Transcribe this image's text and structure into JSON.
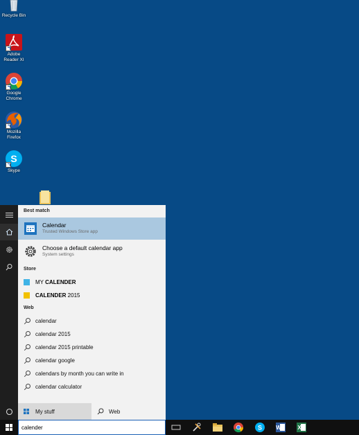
{
  "desktop": {
    "icons": [
      {
        "label": "Recycle Bin",
        "icon": "recycle-bin-icon"
      },
      {
        "label": "Adobe Reader XI",
        "icon": "adobe-reader-icon"
      },
      {
        "label": "Google Chrome",
        "icon": "chrome-icon"
      },
      {
        "label": "Mozilla Firefox",
        "icon": "firefox-icon"
      },
      {
        "label": "Skype",
        "icon": "skype-icon"
      },
      {
        "label": "",
        "icon": "folder-icon"
      }
    ],
    "background_color": "#074a86"
  },
  "search_panel": {
    "best_match_heading": "Best match",
    "best_match": [
      {
        "title": "Calendar",
        "subtitle": "Trusted Windows Store app",
        "icon": "calendar-app-icon",
        "selected": true
      },
      {
        "title": "Choose a default calendar app",
        "subtitle": "System settings",
        "icon": "settings-gear-icon",
        "selected": false
      }
    ],
    "store_heading": "Store",
    "store_items": [
      {
        "prefix": "MY ",
        "bold": "CALENDER",
        "suffix": "",
        "color": "#3fb3e6"
      },
      {
        "prefix": "",
        "bold": "CALENDER",
        "suffix": " 2015",
        "color": "#f2c100"
      }
    ],
    "web_heading": "Web",
    "web_items": [
      "calendar",
      "calendar 2015",
      "calendar 2015 printable",
      "calendar google",
      "calendars by month you can write in",
      "calendar calculator"
    ],
    "filters": {
      "my_stuff": "My stuff",
      "web": "Web"
    },
    "selected_color": "#aac8e0"
  },
  "taskbar": {
    "search_value": "calender",
    "pinned": [
      "task-view-icon",
      "tools-icon",
      "file-explorer-icon",
      "chrome-icon",
      "skype-icon",
      "word-icon",
      "excel-icon"
    ]
  }
}
